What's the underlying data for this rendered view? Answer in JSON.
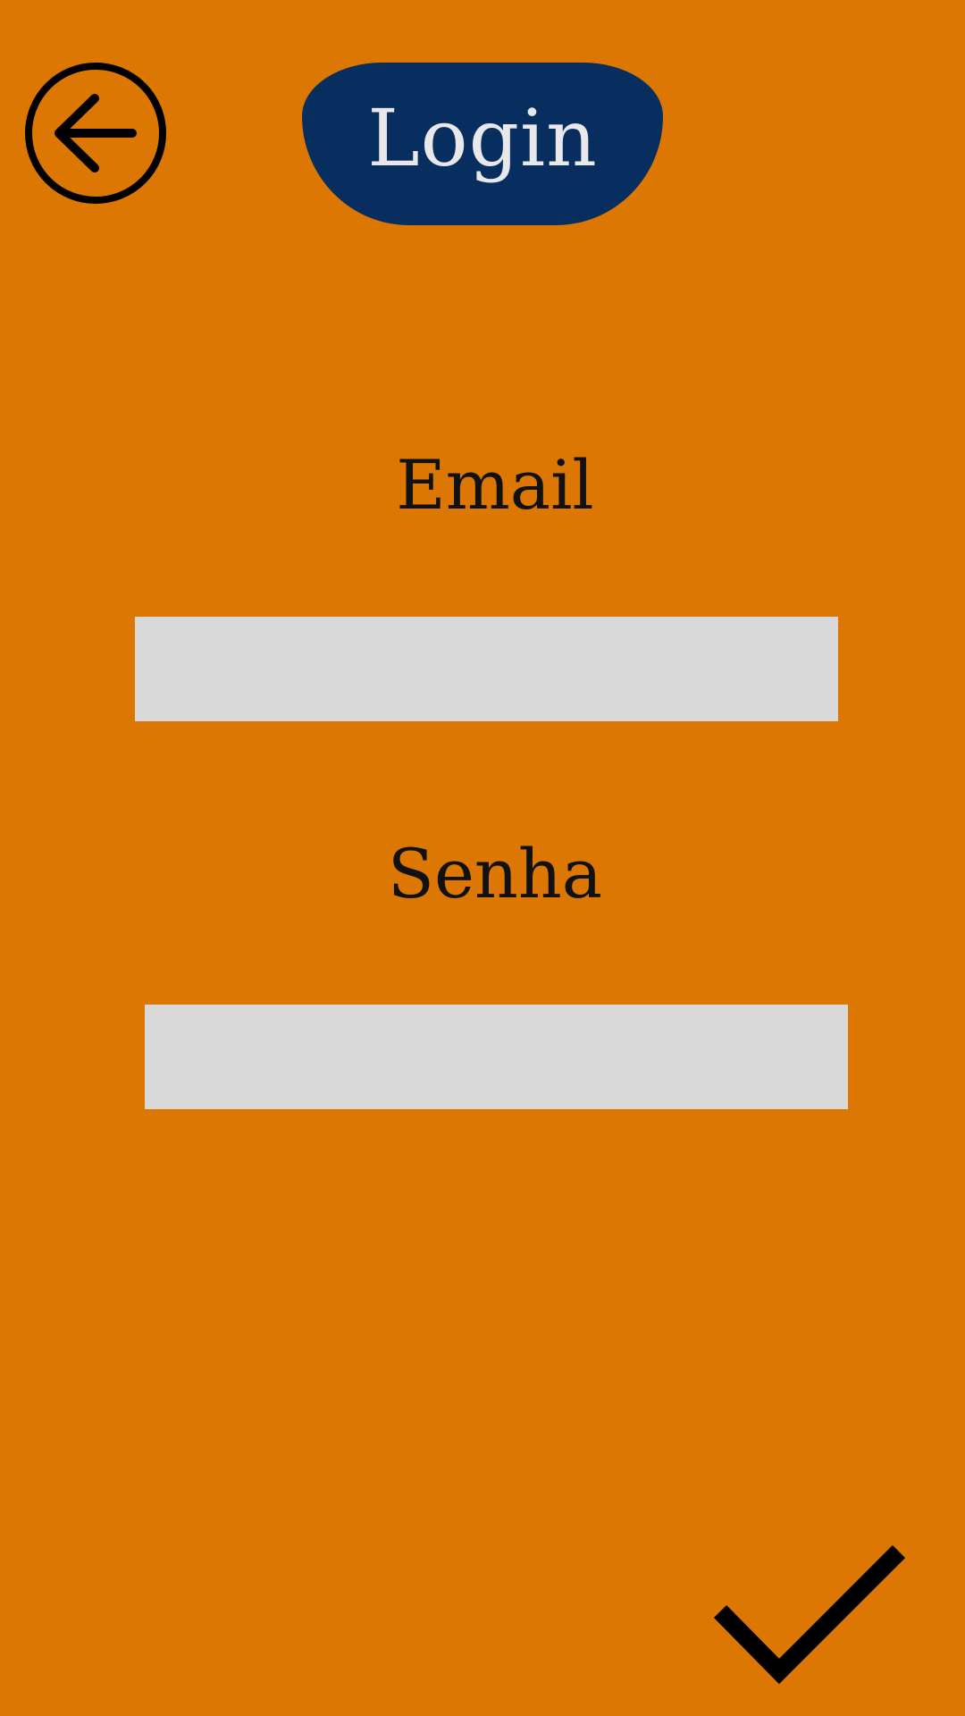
{
  "header": {
    "title": "Login",
    "back_icon": "arrow-left-circle-icon"
  },
  "form": {
    "email_label": "Email",
    "email_value": "",
    "password_label": "Senha",
    "password_value": ""
  },
  "footer": {
    "confirm_icon": "checkmark-icon"
  },
  "colors": {
    "background": "#DC7703",
    "title_pill": "#082D5F",
    "title_text": "#E8E8EA",
    "input_background": "#D9D9D9",
    "label_text": "#111111",
    "icon_stroke": "#000000"
  }
}
